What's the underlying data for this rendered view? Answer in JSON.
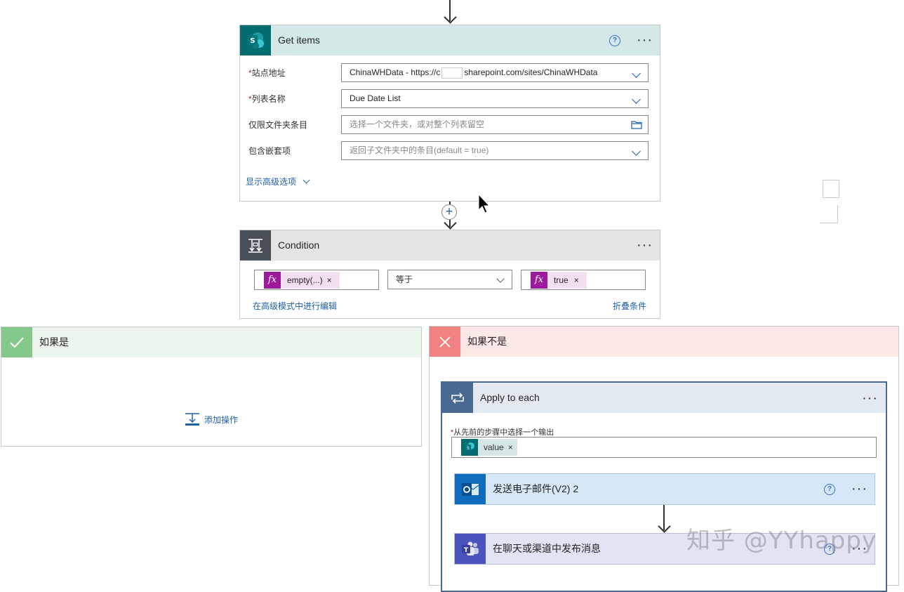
{
  "get_items": {
    "title": "Get items",
    "help": "?",
    "fields": [
      {
        "required": true,
        "label": "站点地址",
        "value": "ChinaWHData - https://c",
        "value_tail": "sharepoint.com/sites/ChinaWHData"
      },
      {
        "required": true,
        "label": "列表名称",
        "value": "Due Date List"
      },
      {
        "required": false,
        "label": "仅限文件夹条目",
        "placeholder": "选择一个文件夹，或对整个列表留空"
      },
      {
        "required": false,
        "label": "包含嵌套项",
        "placeholder": "返回子文件夹中的条目(default = true)"
      }
    ],
    "advanced_link": "显示高级选项"
  },
  "condition": {
    "title": "Condition",
    "left_token": "empty(...)",
    "operator": "等于",
    "right_token": "true",
    "advanced_edit_link": "在高级模式中进行编辑",
    "collapse_link": "折叠条件"
  },
  "if_yes": {
    "title": "如果是",
    "add_action": "添加操作"
  },
  "if_no": {
    "title": "如果不是"
  },
  "apply_each": {
    "title": "Apply to each",
    "select_label": "从先前的步骤中选择一个输出",
    "token": "value"
  },
  "send_email": {
    "title": "发送电子邮件(V2) 2"
  },
  "teams_post": {
    "title": "在聊天或渠道中发布消息"
  },
  "watermark": "知乎 @YYhappy",
  "colors": {
    "sharepoint": "#036c70",
    "condition": "#484f58",
    "yes": "#84c98b",
    "no": "#f08282",
    "loop": "#486991",
    "outlook": "#0f6cbd",
    "teams": "#4b53bc"
  }
}
